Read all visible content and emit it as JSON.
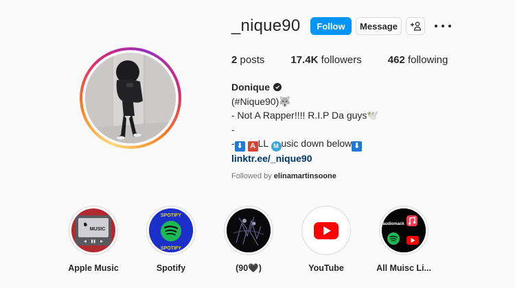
{
  "profile": {
    "username": "_nique90",
    "follow_label": "Follow",
    "message_label": "Message",
    "stats": {
      "posts_count": "2",
      "posts_label": "posts",
      "followers_count": "17.4K",
      "followers_label": "followers",
      "following_count": "462",
      "following_label": "following"
    },
    "bio": {
      "name": "Donique",
      "line1": "(#Nique90)🐺",
      "line2": "- Not A Rapper!!!! R.I.P Da guys🕊️",
      "line3": "-",
      "line4_prefix": "-",
      "line4_box1": "⬇",
      "line4_box2": "A",
      "line4_mid": "LL ",
      "line4_circle": "M",
      "line4_suffix": "usic down below",
      "line4_box3": "⬇",
      "link": "linktr.ee/_nique90",
      "followed_by_prefix": "Followed by ",
      "followed_by_user": "elinamartinsoone"
    }
  },
  "highlights": [
    {
      "label": "Apple Music",
      "cover_text": "MUSIC"
    },
    {
      "label": "Spotify",
      "cover_text": "SPOTIFY"
    },
    {
      "label": "(90🖤)"
    },
    {
      "label": "YouTube"
    },
    {
      "label": "All Muisc Li...",
      "cover_text": "audiomack"
    }
  ],
  "colors": {
    "follow_button": "#0095f6",
    "link": "#00376b",
    "spotify_green": "#1db954",
    "youtube_red": "#ff0000",
    "spotify_cover_blue": "#1c2fc8"
  }
}
